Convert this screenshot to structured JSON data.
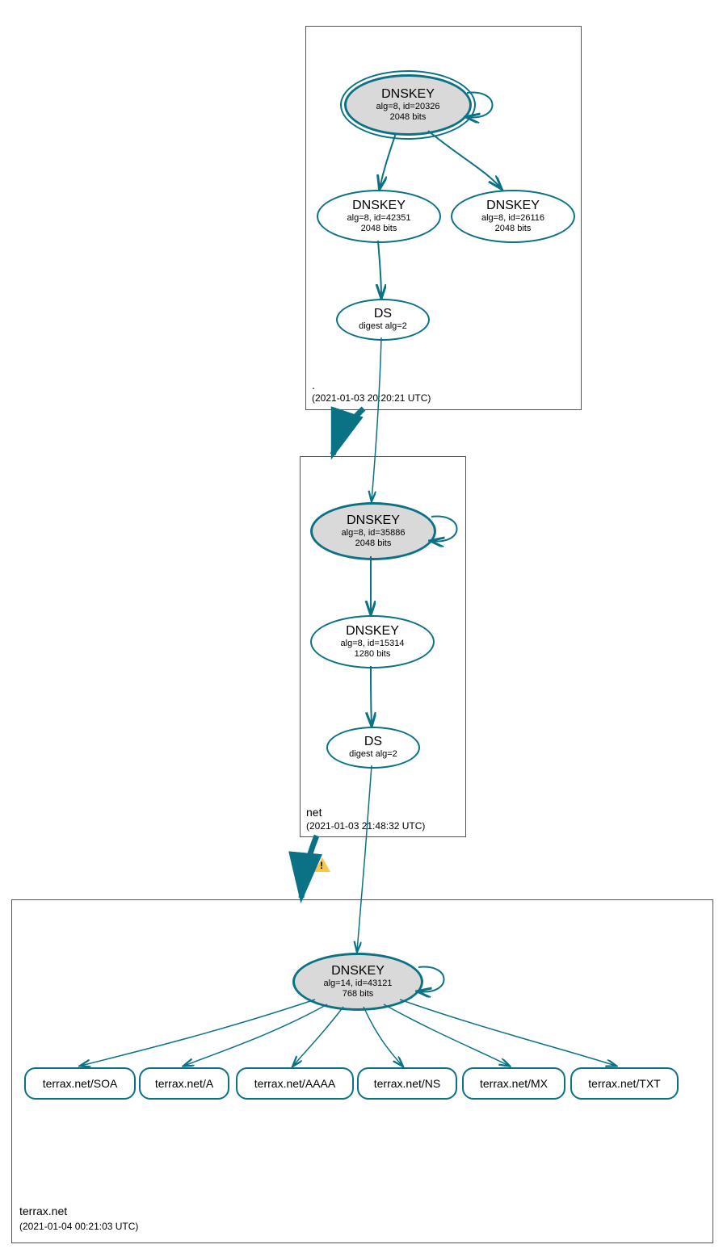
{
  "zones": {
    "root": {
      "label": ".",
      "timestamp": "(2021-01-03 20:20:21 UTC)",
      "nodes": {
        "ksk": {
          "title": "DNSKEY",
          "sub1": "alg=8, id=20326",
          "sub2": "2048 bits"
        },
        "zsk1": {
          "title": "DNSKEY",
          "sub1": "alg=8, id=42351",
          "sub2": "2048 bits"
        },
        "zsk2": {
          "title": "DNSKEY",
          "sub1": "alg=8, id=26116",
          "sub2": "2048 bits"
        },
        "ds": {
          "title": "DS",
          "sub1": "digest alg=2"
        }
      }
    },
    "net": {
      "label": "net",
      "timestamp": "(2021-01-03 21:48:32 UTC)",
      "nodes": {
        "ksk": {
          "title": "DNSKEY",
          "sub1": "alg=8, id=35886",
          "sub2": "2048 bits"
        },
        "zsk": {
          "title": "DNSKEY",
          "sub1": "alg=8, id=15314",
          "sub2": "1280 bits"
        },
        "ds": {
          "title": "DS",
          "sub1": "digest alg=2"
        }
      }
    },
    "terrax": {
      "label": "terrax.net",
      "timestamp": "(2021-01-04 00:21:03 UTC)",
      "nodes": {
        "ksk": {
          "title": "DNSKEY",
          "sub1": "alg=14, id=43121",
          "sub2": "768 bits"
        }
      },
      "rrsets": {
        "soa": "terrax.net/SOA",
        "a": "terrax.net/A",
        "aaaa": "terrax.net/AAAA",
        "ns": "terrax.net/NS",
        "mx": "terrax.net/MX",
        "txt": "terrax.net/TXT"
      }
    }
  }
}
